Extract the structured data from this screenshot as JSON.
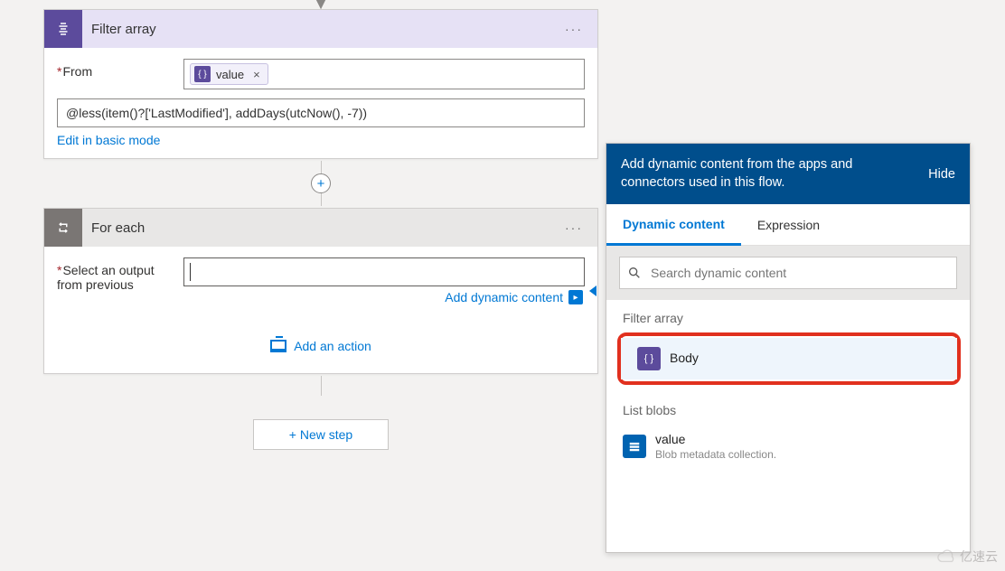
{
  "filter_card": {
    "title": "Filter array",
    "from_label": "From",
    "value_pill": "value",
    "expression": "@less(item()?['LastModified'], addDays(utcNow(), -7))",
    "edit_link": "Edit in basic mode"
  },
  "foreach_card": {
    "title": "For each",
    "select_label_line1": "Select an output",
    "select_label_line2": "from previous",
    "add_dynamic": "Add dynamic content",
    "add_action": "Add an action"
  },
  "new_step": "+ New step",
  "dcp": {
    "banner": "Add dynamic content from the apps and connectors used in this flow.",
    "hide": "Hide",
    "tab_dynamic": "Dynamic content",
    "tab_expression": "Expression",
    "search_placeholder": "Search dynamic content",
    "section1": "Filter array",
    "item_body": "Body",
    "section2": "List blobs",
    "item_value": "value",
    "item_value_desc": "Blob metadata collection."
  },
  "watermark": "亿速云"
}
